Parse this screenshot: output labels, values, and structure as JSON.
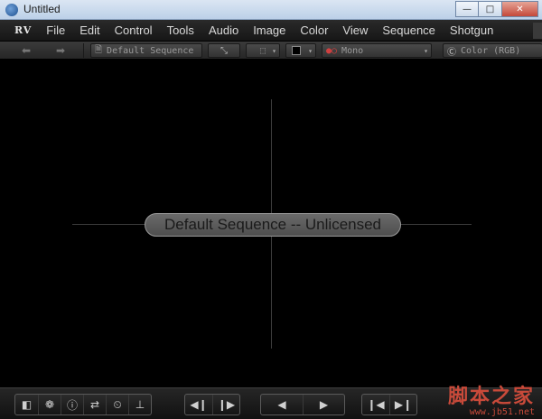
{
  "window": {
    "title": "Untitled",
    "controls": [
      "minimize-icon",
      "maximize-icon",
      "close-icon"
    ]
  },
  "menubar": {
    "logo": "RV",
    "items": [
      "File",
      "Edit",
      "Control",
      "Tools",
      "Audio",
      "Image",
      "Color",
      "View",
      "Sequence",
      "Shotgun"
    ]
  },
  "toolbar": {
    "back_icon": "arrow-left-icon",
    "forward_icon": "arrow-right-icon",
    "source_field": "Default Sequence",
    "display_mode": "Mono",
    "color_space": "Color (RGB)"
  },
  "viewport": {
    "center_label": "Default Sequence -- Unlicensed"
  },
  "bottombar": {
    "left_tools": [
      "session-manager-icon",
      "color-picker-icon",
      "info-icon",
      "swap-icon",
      "timer-icon",
      "download-icon"
    ],
    "frame_step": [
      "step-back-icon",
      "step-forward-icon"
    ],
    "playback": [
      "play-backward-icon",
      "play-forward-icon"
    ],
    "jump": [
      "jump-start-icon",
      "jump-end-icon"
    ]
  },
  "watermark": {
    "main": "脚本之家",
    "sub": "www.jb51.net"
  },
  "colors": {
    "background": "#000000",
    "menubar": "#1e1e1e",
    "toolbar": "#2e2e2e",
    "label_pill": "#5c5c5c"
  }
}
